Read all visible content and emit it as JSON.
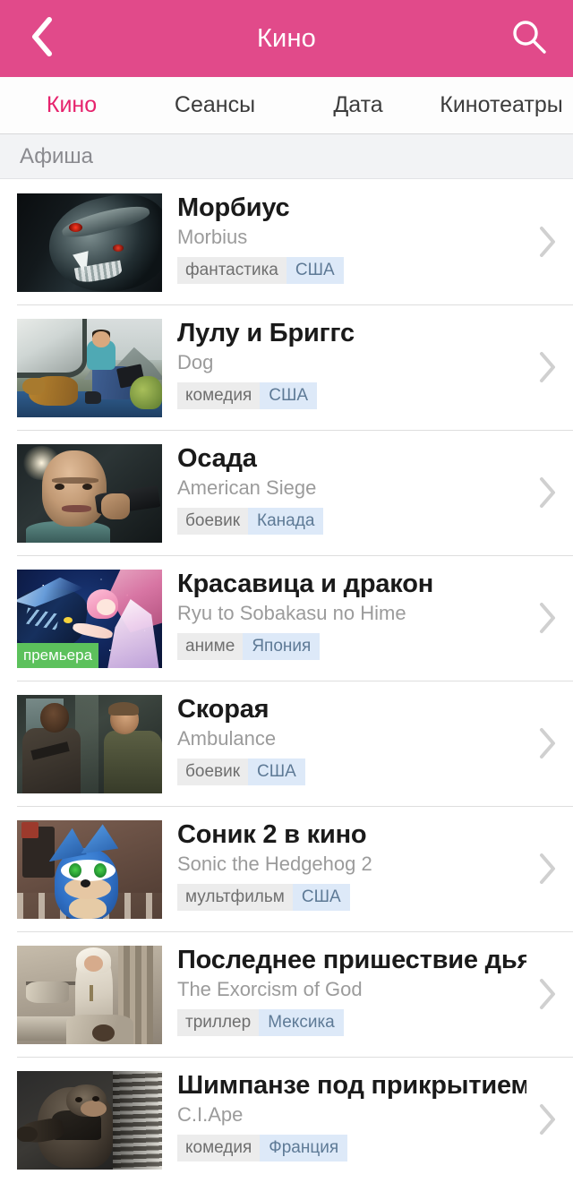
{
  "header": {
    "title": "Кино",
    "back_icon": "chevron-left-icon",
    "search_icon": "search-icon"
  },
  "tabs": [
    {
      "label": "Кино",
      "active": true
    },
    {
      "label": "Сеансы",
      "active": false
    },
    {
      "label": "Дата",
      "active": false
    },
    {
      "label": "Кинотеатры",
      "active": false
    }
  ],
  "section": {
    "label": "Афиша"
  },
  "colors": {
    "header_bg": "#e14a8a",
    "accent": "#e6236d",
    "tab_inactive": "#3c3c3c",
    "section_bg": "#f2f3f5",
    "genre_tag_bg": "#ececec",
    "genre_tag_text": "#6f6f6f",
    "country_tag_bg": "#dde9f8",
    "country_tag_text": "#5e7a96",
    "premiere_badge_bg": "#5cc15c",
    "title_text": "#1a1a1a",
    "subtitle_text": "#9b9b9b",
    "separator": "#dedede",
    "chevron": "#d0d0d0"
  },
  "movies": [
    {
      "title": "Морбиус",
      "original_title": "Morbius",
      "genre": "фантастика",
      "country": "США",
      "badge": null,
      "art": "art-morbius"
    },
    {
      "title": "Лулу и Бриггс",
      "original_title": "Dog",
      "genre": "комедия",
      "country": "США",
      "badge": null,
      "art": "art-dog"
    },
    {
      "title": "Осада",
      "original_title": "American Siege",
      "genre": "боевик",
      "country": "Канада",
      "badge": null,
      "art": "art-siege"
    },
    {
      "title": "Красавица и дракон",
      "original_title": "Ryu to Sobakasu no Hime",
      "genre": "аниме",
      "country": "Япония",
      "badge": "премьера",
      "art": "art-belle"
    },
    {
      "title": "Скорая",
      "original_title": "Ambulance",
      "genre": "боевик",
      "country": "США",
      "badge": null,
      "art": "art-amb"
    },
    {
      "title": "Соник 2 в кино",
      "original_title": "Sonic the Hedgehog 2",
      "genre": "мультфильм",
      "country": "США",
      "badge": null,
      "art": "art-sonic"
    },
    {
      "title": "Последнее пришествие дья…",
      "original_title": "The Exorcism of God",
      "genre": "триллер",
      "country": "Мексика",
      "badge": null,
      "art": "art-exor"
    },
    {
      "title": "Шимпанзе под прикрытием",
      "original_title": "C.I.Ape",
      "genre": "комедия",
      "country": "Франция",
      "badge": null,
      "art": "art-ape"
    }
  ]
}
